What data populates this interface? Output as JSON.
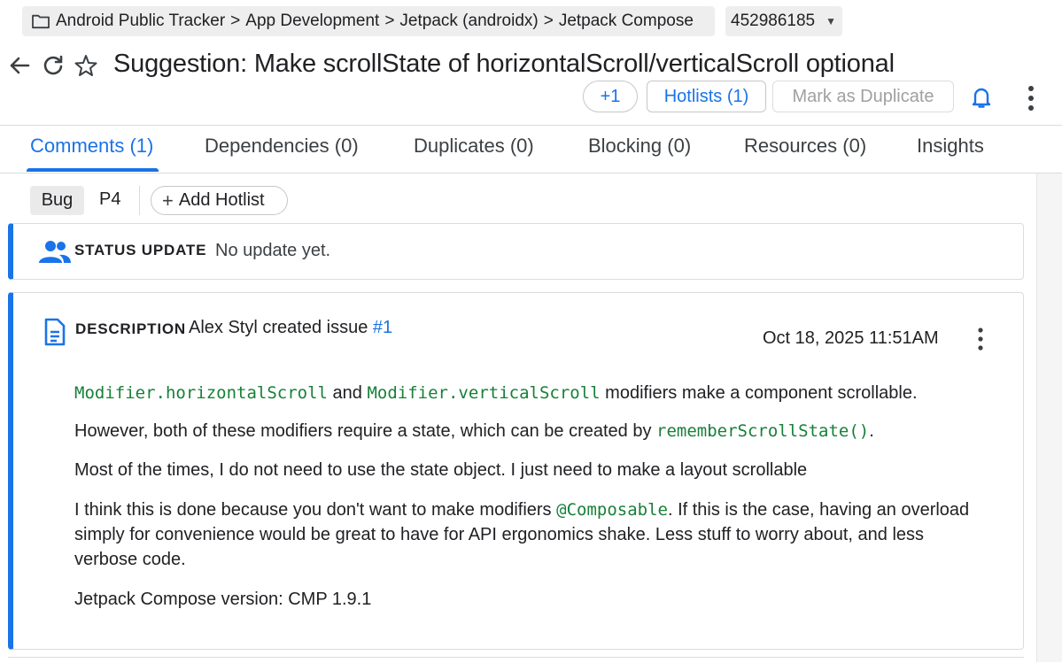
{
  "breadcrumb": {
    "items": [
      "Android Public Tracker",
      "App Development",
      "Jetpack (androidx)",
      "Jetpack Compose"
    ],
    "separator": ">"
  },
  "issue_id": "452986185",
  "title": "Suggestion: Make scrollState of horizontalScroll/verticalScroll optional",
  "actions": {
    "plus_one": "+1",
    "hotlists": "Hotlists (1)",
    "mark_duplicate": "Mark as Duplicate"
  },
  "tabs": [
    {
      "label": "Comments (1)",
      "active": true
    },
    {
      "label": "Dependencies (0)",
      "active": false
    },
    {
      "label": "Duplicates (0)",
      "active": false
    },
    {
      "label": "Blocking (0)",
      "active": false
    },
    {
      "label": "Resources (0)",
      "active": false
    },
    {
      "label": "Insights",
      "active": false
    }
  ],
  "chips": {
    "type": "Bug",
    "priority": "P4",
    "add_hotlist": "Add Hotlist"
  },
  "status_update": {
    "label": "STATUS UPDATE",
    "value": "No update yet."
  },
  "description": {
    "label": "DESCRIPTION",
    "creator_text": "Alex Styl created issue",
    "issue_link": "#1",
    "date": "Oct 18, 2025 11:51AM",
    "para1": {
      "code1": "Modifier.horizontalScroll",
      "and": "and",
      "code2": "Modifier.verticalScroll",
      "rest": "modifiers make a component scrollable."
    },
    "para2": {
      "text": "However, both of these modifiers require a state, which can be created by",
      "code": "rememberScrollState()",
      "end": "."
    },
    "para3": "Most of the times, I do not need to use the state object. I just need to make a layout scrollable",
    "para4": {
      "text1": "I think this is done because you don't want to make modifiers",
      "code": "@Composable",
      "text2": ". If this is the case, having an overload simply for convenience would be great to have for API ergonomics shake. Less stuff to worry about, and less verbose code."
    },
    "para5": "Jetpack Compose version: CMP 1.9.1"
  },
  "colors": {
    "accent": "#1a73e8",
    "code_green": "#188038",
    "chip_bg": "#eaeaea"
  }
}
